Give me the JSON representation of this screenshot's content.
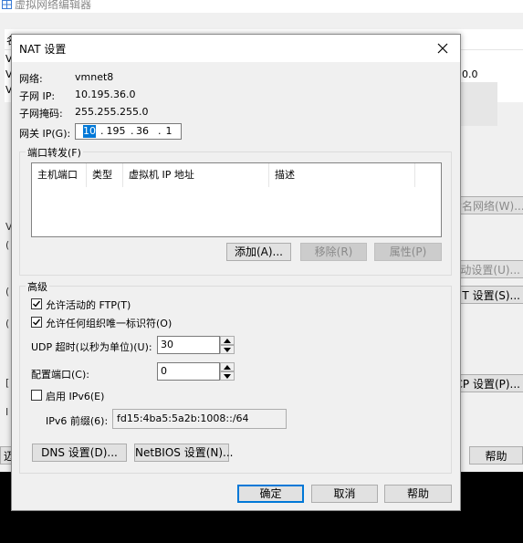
{
  "background": {
    "title": "虚拟网络编辑器",
    "table_header_fragment": "名",
    "row_fragments": [
      "V",
      "V",
      "V"
    ],
    "cell_fragment": "0.0",
    "side_fragments": [
      "V",
      "(",
      "(",
      "(",
      "[",
      "I",
      "迈"
    ],
    "buttons": {
      "rename": "命名网络(W)...",
      "auto_settings": "动设置(U)...",
      "nat_settings": "T 设置(S)...",
      "dhcp_settings": "CP 设置(P)...",
      "help": "帮助"
    }
  },
  "dialog": {
    "title": "NAT 设置",
    "network_label": "网络:",
    "network_value": "vmnet8",
    "subnet_ip_label": "子网 IP:",
    "subnet_ip_value": "10.195.36.0",
    "subnet_mask_label": "子网掩码:",
    "subnet_mask_value": "255.255.255.0",
    "gateway_label": "网关 IP(G):",
    "gateway_octets": [
      "10",
      "195",
      "36",
      "1"
    ],
    "port_forwarding": {
      "group_title": "端口转发(F)",
      "columns": [
        "主机端口",
        "类型",
        "虚拟机 IP 地址",
        "描述"
      ],
      "add_button": "添加(A)...",
      "remove_button": "移除(R)",
      "properties_button": "属性(P)"
    },
    "advanced": {
      "group_title": "高级",
      "allow_ftp_label": "允许活动的 FTP(T)",
      "allow_ftp_checked": true,
      "allow_oui_label": "允许任何组织唯一标识符(O)",
      "allow_oui_checked": true,
      "udp_timeout_label": "UDP 超时(以秒为单位)(U):",
      "udp_timeout_value": "30",
      "config_port_label": "配置端口(C):",
      "config_port_value": "0",
      "enable_ipv6_label": "启用 IPv6(E)",
      "enable_ipv6_checked": false,
      "ipv6_prefix_label": "IPv6 前缀(6):",
      "ipv6_prefix_value": "fd15:4ba5:5a2b:1008::/64",
      "dns_button": "DNS 设置(D)...",
      "netbios_button": "NetBIOS 设置(N)..."
    },
    "ok_button": "确定",
    "cancel_button": "取消",
    "help_button": "帮助"
  }
}
